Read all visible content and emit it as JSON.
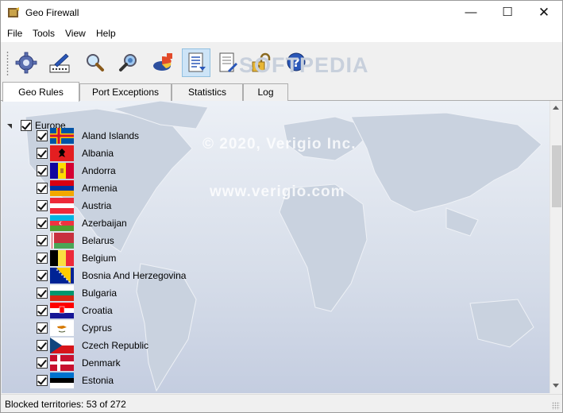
{
  "window": {
    "title": "Geo Firewall"
  },
  "menu": [
    "File",
    "Tools",
    "View",
    "Help"
  ],
  "toolbar": {
    "buttons": [
      "settings-icon",
      "edit-icon",
      "search-icon",
      "lookup-icon",
      "chart-icon",
      "list-icon",
      "report-icon",
      "unlock-icon",
      "help-icon"
    ]
  },
  "watermark": {
    "top": "SOFTPEDIA",
    "copyright": "© 2020, Verigio Inc.",
    "url": "www.verigio.com"
  },
  "tabs": [
    "Geo Rules",
    "Port Exceptions",
    "Statistics",
    "Log"
  ],
  "tree": {
    "group": "Europe",
    "countries": [
      "Aland Islands",
      "Albania",
      "Andorra",
      "Armenia",
      "Austria",
      "Azerbaijan",
      "Belarus",
      "Belgium",
      "Bosnia And Herzegovina",
      "Bulgaria",
      "Croatia",
      "Cyprus",
      "Czech Republic",
      "Denmark",
      "Estonia"
    ]
  },
  "status": {
    "text": "Blocked territories: 53 of 272"
  },
  "colors": {
    "selected_tab_bg": "#ffffff",
    "pressed_button": "#cde4f7",
    "content_bg": "#dbe2ec"
  }
}
